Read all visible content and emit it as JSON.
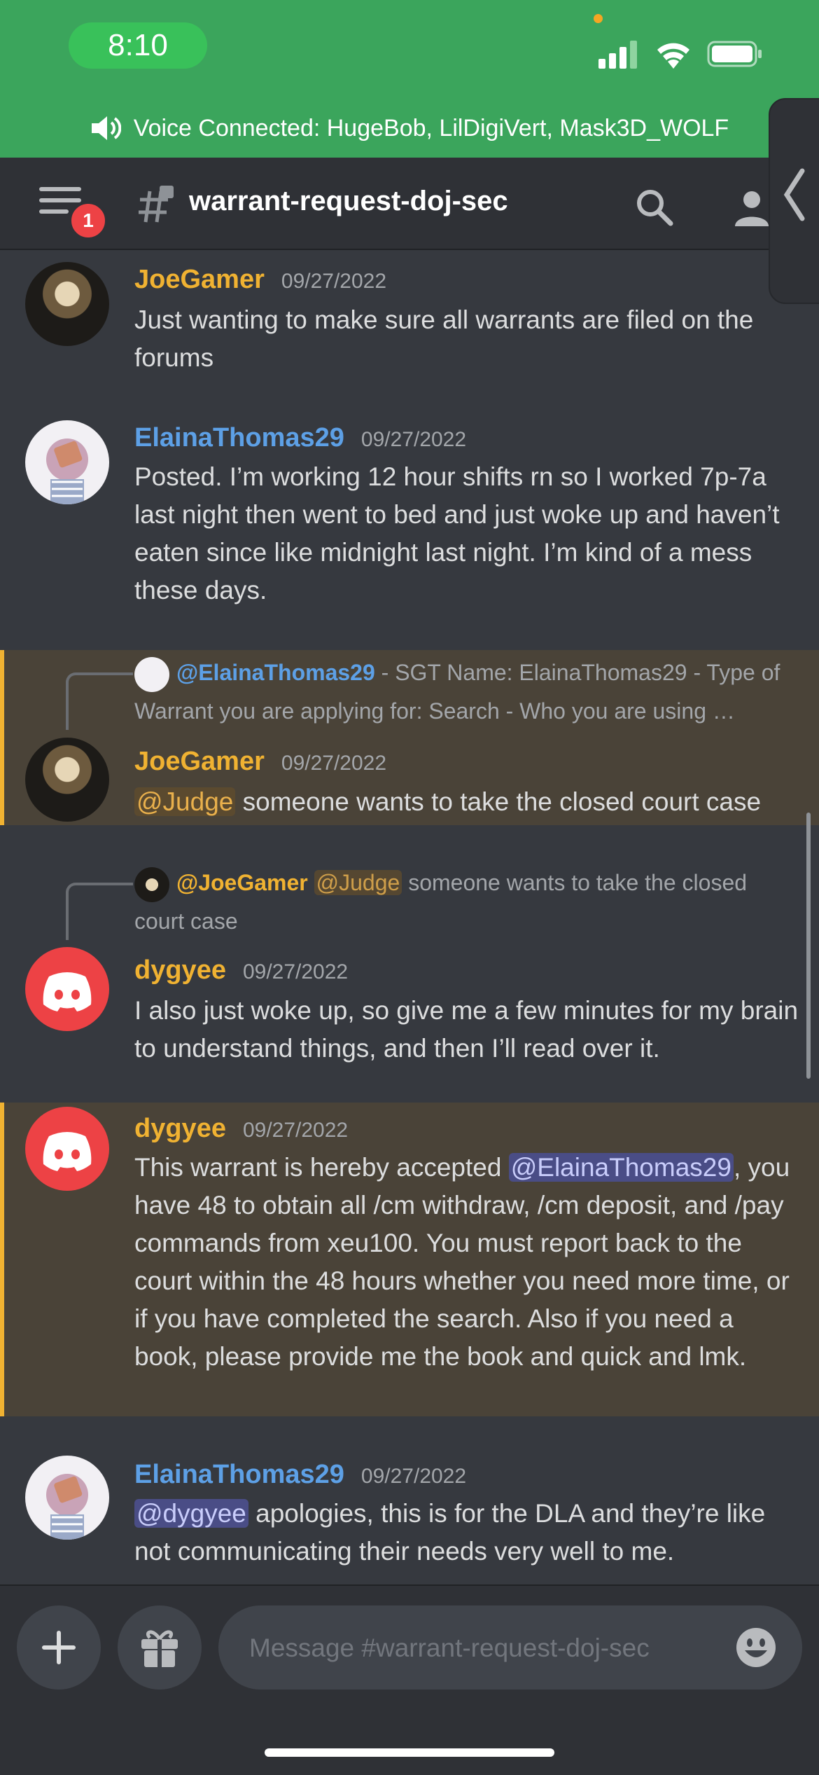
{
  "status_bar": {
    "time": "8:10"
  },
  "voice_bar": {
    "text": "Voice Connected: HugeBob, LilDigiVert, Mask3D_WOLF"
  },
  "header": {
    "channel_name": "warrant-request-doj-sec",
    "notification_count": "1"
  },
  "messages": [
    {
      "author": "JoeGamer",
      "date": "09/27/2022",
      "text": "Just wanting to make sure all warrants are filed on the forums"
    },
    {
      "author": "ElainaThomas29",
      "date": "09/27/2022",
      "text": "Posted. I’m working 12 hour shifts rn so I worked 7p-7a last night then went to bed and just woke up and haven’t eaten since like midnight last night. I’m kind of a mess these days."
    },
    {
      "reply": {
        "author": "@ElainaThomas29",
        "text": " - SGT Name: ElainaThomas29 - Type of Warrant you are applying for: Search - Who you are using …"
      },
      "author": "JoeGamer",
      "date": "09/27/2022",
      "mention": "@Judge",
      "text": " someone wants to take the closed court case"
    },
    {
      "reply": {
        "author": "@JoeGamer",
        "mention": "@Judge",
        "text": " someone wants to take the closed court case"
      },
      "author": "dygyee",
      "date": "09/27/2022",
      "text": "I also just woke up, so give me a few minutes for my brain to understand things, and then I’ll read over it."
    },
    {
      "author": "dygyee",
      "date": "09/27/2022",
      "text_before": "This warrant is hereby accepted ",
      "mention": "@ElainaThomas29",
      "text_after": ", you have 48 to obtain all /cm withdraw, /cm deposit, and /pay commands from xeu100. You must report back to the court within the 48 hours whether you need more time, or if you have completed the search. Also if you need a book, please provide me the book and quick and lmk."
    },
    {
      "author": "ElainaThomas29",
      "date": "09/27/2022",
      "mention": "@dygyee",
      "text": " apologies, this is for the DLA and they’re like not communicating their needs very well to me."
    }
  ],
  "composer": {
    "placeholder": "Message #warrant-request-doj-sec"
  },
  "colors": {
    "background": "#36393f",
    "header": "#2f3136",
    "voice_green": "#3ba55c",
    "highlight": "#4a4338",
    "highlight_bar": "#f0b232",
    "discord_red": "#ed4245"
  },
  "icons": [
    "speaker-icon",
    "hamburger-icon",
    "channel-hash-icon",
    "search-icon",
    "members-icon",
    "chevron-left-icon",
    "plus-icon",
    "gift-icon",
    "emoji-icon"
  ]
}
